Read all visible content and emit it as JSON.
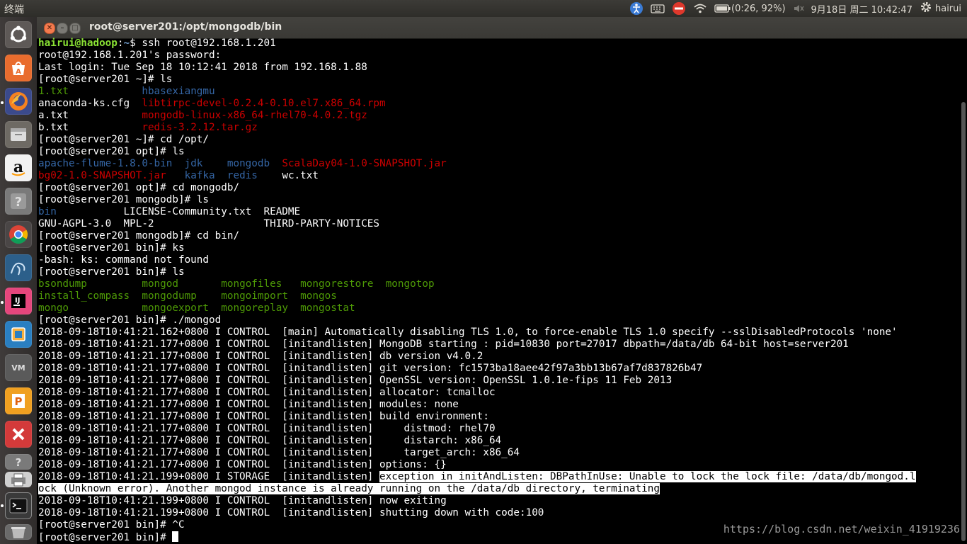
{
  "panel": {
    "app_title": "终端",
    "battery_text": "(0:26, 92%)",
    "clock": "9月18日 周二 10:42:47",
    "user": "hairui",
    "icons": [
      "accessibility-icon",
      "keyboard-icon",
      "no-entry-icon",
      "wifi-icon",
      "battery-icon",
      "volume-icon",
      "gear-icon"
    ]
  },
  "launcher": [
    "ubuntu-dash-icon",
    "software-center-icon",
    "firefox-icon",
    "files-icon",
    "amazon-icon",
    "help-icon",
    "chrome-icon",
    "mysql-workbench-icon",
    "intellij-icon",
    "virtualbox-icon",
    "vmware-icon",
    "wps-icon",
    "xmind-icon",
    "help-icon",
    "printer-icon",
    "terminal-icon",
    "trash-icon"
  ],
  "window": {
    "title": "root@server201:/opt/mongodb/bin"
  },
  "terminal": {
    "lines": [
      [
        [
          "hairui@hadoop",
          "prompt-user"
        ],
        [
          ":",
          "c-white"
        ],
        [
          "~",
          "prompt-path"
        ],
        [
          "$ ssh root@192.168.1.201",
          "c-white"
        ]
      ],
      [
        [
          "root@192.168.1.201's password:",
          "c-white"
        ]
      ],
      [
        [
          "Last login: Tue Sep 18 10:12:41 2018 from 192.168.1.88",
          "c-white"
        ]
      ],
      [
        [
          "[root@server201 ~]# ls",
          "c-white"
        ]
      ],
      [
        [
          "1.txt",
          "c-green"
        ],
        [
          "            ",
          ""
        ],
        [
          "hbasexiangmu",
          "c-blue"
        ]
      ],
      [
        [
          "anaconda-ks.cfg",
          "c-white"
        ],
        [
          "  ",
          ""
        ],
        [
          "libtirpc-devel-0.2.4-0.10.el7.x86_64.rpm",
          "c-red"
        ]
      ],
      [
        [
          "a.txt",
          "c-white"
        ],
        [
          "            ",
          ""
        ],
        [
          "mongodb-linux-x86_64-rhel70-4.0.2.tgz",
          "c-red"
        ]
      ],
      [
        [
          "b.txt",
          "c-white"
        ],
        [
          "            ",
          ""
        ],
        [
          "redis-3.2.12.tar.gz",
          "c-red"
        ]
      ],
      [
        [
          "[root@server201 ~]# cd /opt/",
          "c-white"
        ]
      ],
      [
        [
          "[root@server201 opt]# ls",
          "c-white"
        ]
      ],
      [
        [
          "apache-flume-1.8.0-bin",
          "c-blue"
        ],
        [
          "  ",
          ""
        ],
        [
          "jdk",
          "c-blue"
        ],
        [
          "    ",
          ""
        ],
        [
          "mongodb",
          "c-blue"
        ],
        [
          "  ",
          ""
        ],
        [
          "ScalaDay04-1.0-SNAPSHOT.jar",
          "c-red"
        ]
      ],
      [
        [
          "bg02-1.0-SNAPSHOT.jar",
          "c-red"
        ],
        [
          "   ",
          ""
        ],
        [
          "kafka",
          "c-blue"
        ],
        [
          "  ",
          ""
        ],
        [
          "redis",
          "c-blue"
        ],
        [
          "    ",
          ""
        ],
        [
          "wc.txt",
          "c-white"
        ]
      ],
      [
        [
          "[root@server201 opt]# cd mongodb/",
          "c-white"
        ]
      ],
      [
        [
          "[root@server201 mongodb]# ls",
          "c-white"
        ]
      ],
      [
        [
          "bin",
          "c-blue"
        ],
        [
          "           LICENSE-Community.txt  README",
          "c-white"
        ]
      ],
      [
        [
          "GNU-AGPL-3.0  MPL-2                  THIRD-PARTY-NOTICES",
          "c-white"
        ]
      ],
      [
        [
          "[root@server201 mongodb]# cd bin/",
          "c-white"
        ]
      ],
      [
        [
          "[root@server201 bin]# ks",
          "c-white"
        ]
      ],
      [
        [
          "-bash: ks: command not found",
          "c-white"
        ]
      ],
      [
        [
          "[root@server201 bin]# ls",
          "c-white"
        ]
      ],
      [
        [
          "bsondump",
          "c-green"
        ],
        [
          "         ",
          ""
        ],
        [
          "mongod",
          "c-green"
        ],
        [
          "       ",
          ""
        ],
        [
          "mongofiles",
          "c-green"
        ],
        [
          "   ",
          ""
        ],
        [
          "mongorestore",
          "c-green"
        ],
        [
          "  ",
          ""
        ],
        [
          "mongotop",
          "c-green"
        ]
      ],
      [
        [
          "install_compass",
          "c-green"
        ],
        [
          "  ",
          ""
        ],
        [
          "mongodump",
          "c-green"
        ],
        [
          "    ",
          ""
        ],
        [
          "mongoimport",
          "c-green"
        ],
        [
          "  ",
          ""
        ],
        [
          "mongos",
          "c-green"
        ]
      ],
      [
        [
          "mongo",
          "c-green"
        ],
        [
          "            ",
          ""
        ],
        [
          "mongoexport",
          "c-green"
        ],
        [
          "  ",
          ""
        ],
        [
          "mongoreplay",
          "c-green"
        ],
        [
          "  ",
          ""
        ],
        [
          "mongostat",
          "c-green"
        ]
      ],
      [
        [
          "[root@server201 bin]# ./mongod",
          "c-white"
        ]
      ],
      [
        [
          "2018-09-18T10:41:21.162+0800 I CONTROL  [main] Automatically disabling TLS 1.0, to force-enable TLS 1.0 specify --sslDisabledProtocols 'none'",
          "c-white"
        ]
      ],
      [
        [
          "2018-09-18T10:41:21.177+0800 I CONTROL  [initandlisten] MongoDB starting : pid=10830 port=27017 dbpath=/data/db 64-bit host=server201",
          "c-white"
        ]
      ],
      [
        [
          "2018-09-18T10:41:21.177+0800 I CONTROL  [initandlisten] db version v4.0.2",
          "c-white"
        ]
      ],
      [
        [
          "2018-09-18T10:41:21.177+0800 I CONTROL  [initandlisten] git version: fc1573ba18aee42f97a3bb13b67af7d837826b47",
          "c-white"
        ]
      ],
      [
        [
          "2018-09-18T10:41:21.177+0800 I CONTROL  [initandlisten] OpenSSL version: OpenSSL 1.0.1e-fips 11 Feb 2013",
          "c-white"
        ]
      ],
      [
        [
          "2018-09-18T10:41:21.177+0800 I CONTROL  [initandlisten] allocator: tcmalloc",
          "c-white"
        ]
      ],
      [
        [
          "2018-09-18T10:41:21.177+0800 I CONTROL  [initandlisten] modules: none",
          "c-white"
        ]
      ],
      [
        [
          "2018-09-18T10:41:21.177+0800 I CONTROL  [initandlisten] build environment:",
          "c-white"
        ]
      ],
      [
        [
          "2018-09-18T10:41:21.177+0800 I CONTROL  [initandlisten]     distmod: rhel70",
          "c-white"
        ]
      ],
      [
        [
          "2018-09-18T10:41:21.177+0800 I CONTROL  [initandlisten]     distarch: x86_64",
          "c-white"
        ]
      ],
      [
        [
          "2018-09-18T10:41:21.177+0800 I CONTROL  [initandlisten]     target_arch: x86_64",
          "c-white"
        ]
      ],
      [
        [
          "2018-09-18T10:41:21.177+0800 I CONTROL  [initandlisten] options: {}",
          "c-white"
        ]
      ],
      [
        [
          "2018-09-18T10:41:21.199+0800 I STORAGE  [initandlisten] ",
          "c-white"
        ],
        [
          "exception in initAndListen: DBPathInUse: Unable to lock the lock file: /data/db/mongod.l",
          "hl"
        ]
      ],
      [
        [
          "ock (Unknown error). Another mongod instance is already running on the /data/db directory, terminating",
          "hl"
        ]
      ],
      [
        [
          "2018-09-18T10:41:21.199+0800 I CONTROL  [initandlisten] now exiting",
          "c-white"
        ]
      ],
      [
        [
          "2018-09-18T10:41:21.199+0800 I CONTROL  [initandlisten] shutting down with code:100",
          "c-white"
        ]
      ],
      [
        [
          "[root@server201 bin]# ^C",
          "c-white"
        ]
      ],
      [
        [
          "[root@server201 bin]# ",
          "c-white"
        ]
      ]
    ]
  },
  "watermark": "https://blog.csdn.net/weixin_41919236",
  "colors": {
    "prompt_user": "#8ae234",
    "prompt_path": "#729fcf",
    "exec_green": "#4e9a06",
    "dir_blue": "#3465a4",
    "archive_red": "#cc0000"
  }
}
